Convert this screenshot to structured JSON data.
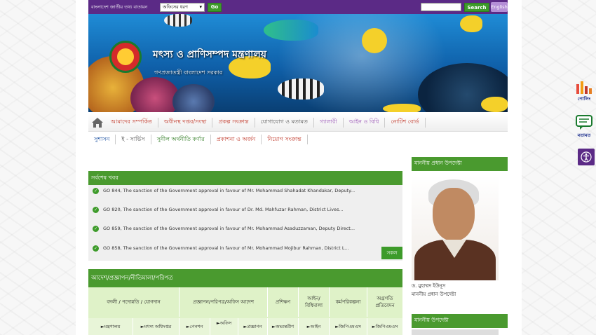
{
  "topbar": {
    "portal_name": "বাংলাদেশ জাতীয় তথ্য বাতায়ন",
    "office_select": "অফিসের ধরণ",
    "go_label": "Go",
    "search_value": "",
    "search_label": "Search",
    "english_label": "English"
  },
  "banner": {
    "ministry": "মৎস্য ও প্রাণিসম্পদ মন্ত্রণালয়",
    "govt": "গণপ্রজাতন্ত্রী বাংলাদেশ সরকার"
  },
  "nav": {
    "row1": [
      {
        "label": "আমাদের সম্পর্কিত",
        "color": "#c0392b"
      },
      {
        "label": "অধীনস্থ দপ্তর/সংস্থা",
        "color": "#c0392b"
      },
      {
        "label": "প্রকল্প সংক্রান্ত",
        "color": "#c0392b"
      },
      {
        "label": "যোগাযোগ ও মতামত",
        "color": "#555555"
      },
      {
        "label": "গ্যালারী",
        "color": "#9b59b6"
      },
      {
        "label": "আইন ও বিধি",
        "color": "#9b59b6"
      },
      {
        "label": "নোটিশ বোর্ড",
        "color": "#c0392b"
      }
    ],
    "row2": [
      {
        "label": "সুশাসন",
        "color": "#1a4fa0"
      },
      {
        "label": "ই - সার্ভিস",
        "color": "#555555"
      },
      {
        "label": "সুনীল অর্থনীতি কর্ণার",
        "color": "#2d7a1f"
      },
      {
        "label": "প্রকাশনা ও অর্জন",
        "color": "#c0392b"
      },
      {
        "label": "নিয়োগ সংক্রান্ত",
        "color": "#c0392b"
      }
    ]
  },
  "news": {
    "title": "সর্বশেষ খবর",
    "items": [
      "GO 844, The sanction of the Government approval in favour of Mr. Mohammad Shahadat Khandakar, Deputy...",
      "GO 820, The sanction of the Government approval in favour of Dr. Md. Mahfuzar Rahman, District Lives...",
      "GO 859, The sanction of the Government approval in favour of Mr. Mohammad Asaduzzaman, Deputy Direct...",
      "GO 858, The sanction of the Government approval in favour of Mr. Mohammad Mojibur Rahman, District L..."
    ],
    "more": "সকল"
  },
  "orders": {
    "title": "আদেশ/প্রজ্ঞাপন/নীতিমালা/পরিপত্র",
    "headers": [
      "বদলী / পদোন্নতি / যোগদান",
      "প্রজ্ঞাপন/পরিপত্র/অফিস আদেশ",
      "প্রশিক্ষণ",
      "আইন/\nবিধিমালা",
      "কর্মপরিকল্পনা",
      "অগ্রগতি\nপ্রতিবেদন"
    ],
    "subs": [
      "►মন্ত্রণালয়",
      "►মৎস্য অধিদপ্তর",
      "►পেনশন",
      "►অফিস",
      "►প্রজ্ঞাপন",
      "►অভ্যন্তরীণ",
      "►আইন",
      "►জিপিএমএস",
      "►জিপিএমএস"
    ]
  },
  "sidebar": {
    "adviser_head": "মাননীয় প্রধান উপদেষ্টা",
    "adviser_name": "ড. মুহাম্মদ ইউনূস",
    "adviser_title": "মাননীয় প্রধান উপদেষ্টা",
    "adviser2_head": "মাননীয় উপদেষ্টা"
  },
  "floating": {
    "polling": "পোলিং",
    "opinion": "মতামত"
  }
}
